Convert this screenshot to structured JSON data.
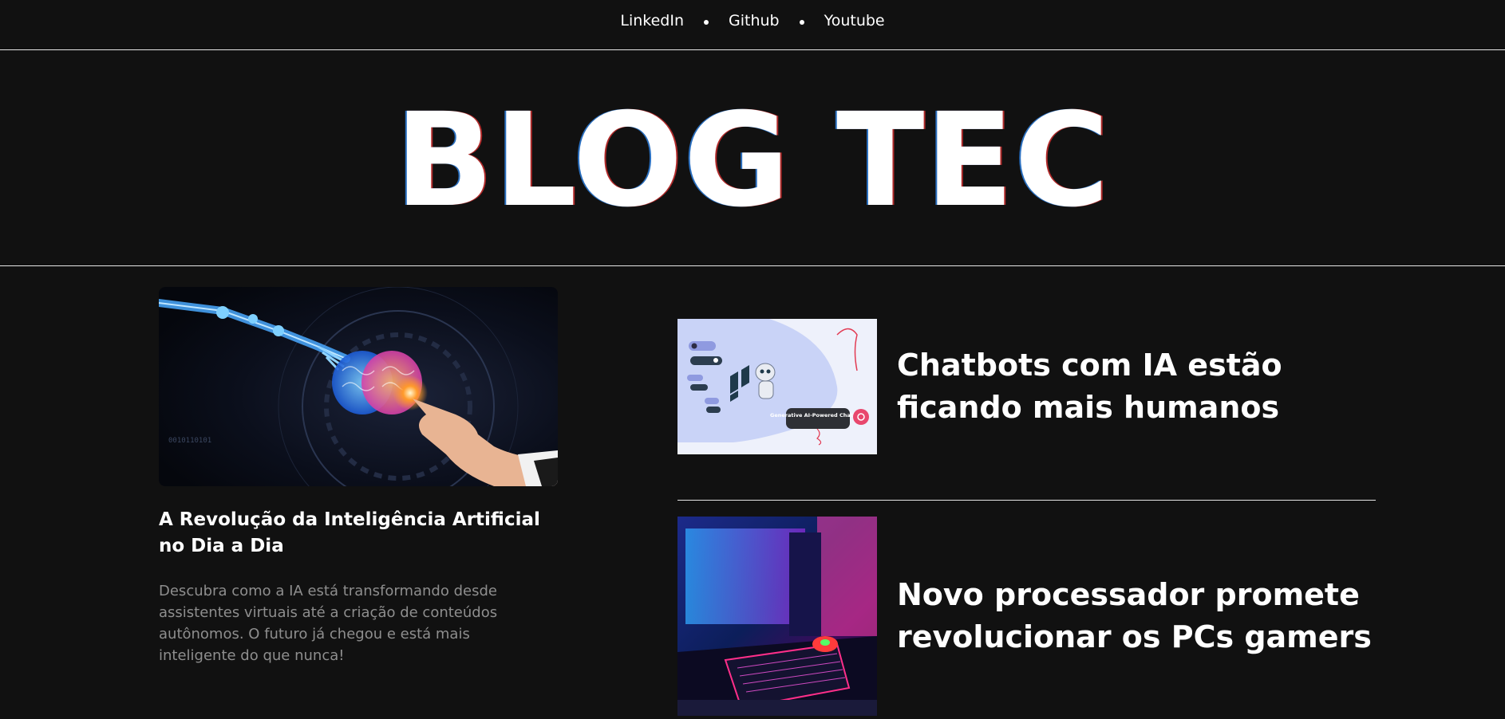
{
  "nav": {
    "items": [
      {
        "label": "LinkedIn"
      },
      {
        "label": "Github"
      },
      {
        "label": "Youtube"
      }
    ]
  },
  "hero": {
    "title": "BLOG TEC"
  },
  "featured": {
    "title": "A Revolução da Inteligência Artificial no Dia a Dia",
    "summary": "Descubra como a IA está transformando desde assistentes virtuais até a criação de conteúdos autônomos. O futuro já chegou e está mais inteligente do que nunca!",
    "image_icon": "ai-brain-image"
  },
  "side_articles": [
    {
      "title": "Chatbots com IA estão ficando mais humanos",
      "image_icon": "chatbot-illustration-image",
      "image_caption": "Generative AI-Powered Chatbots"
    },
    {
      "title": "Novo processador promete revolucionar os PCs gamers",
      "image_icon": "gaming-setup-image"
    }
  ],
  "colors": {
    "background": "#111111",
    "text": "#ffffff",
    "muted_text": "#8e8e8e",
    "divider": "#e6e6e6"
  }
}
